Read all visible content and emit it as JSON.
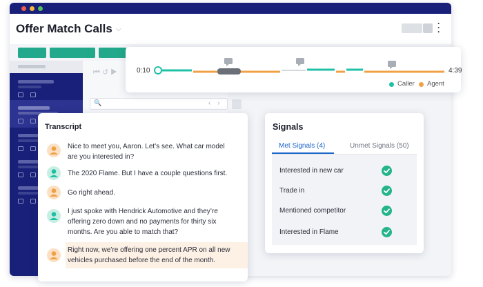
{
  "header": {
    "title": "Offer Match Calls"
  },
  "timeline": {
    "start_time": "0:10",
    "end_time": "4:39",
    "legend": [
      {
        "label": "Caller",
        "color": "#1fc1a6"
      },
      {
        "label": "Agent",
        "color": "#f0a045"
      }
    ],
    "comment_icon": "comment-icon"
  },
  "transcript": {
    "title": "Transcript",
    "messages": [
      {
        "speaker": "agent",
        "line1": "Nice to meet you, Aaron. Let’s see. What car model",
        "line2": "are you interested in?"
      },
      {
        "speaker": "caller",
        "line1": "The 2020 Flame. But I have a couple questions first.",
        "line2": ""
      },
      {
        "speaker": "agent",
        "line1": "Go right ahead.",
        "line2": ""
      },
      {
        "speaker": "caller",
        "line1": "I just spoke with Hendrick Automotive and they’re",
        "line2": "offering zero down and no payments for thirty six",
        "line3": "months. Are you able to match that?"
      },
      {
        "speaker": "agent",
        "line1": "Right now, we’re offering one percent APR on all new",
        "line2": "vehicles purchased before the end of the month.",
        "highlighted": true
      }
    ]
  },
  "signals": {
    "title": "Signals",
    "tabs": [
      {
        "label": "Met Signals (4)",
        "active": true
      },
      {
        "label": "Unmet Signals (50)",
        "active": false
      }
    ],
    "items": [
      {
        "label": "Interested in new car",
        "met": true
      },
      {
        "label": "Trade in",
        "met": true
      },
      {
        "label": "Mentioned competitor",
        "met": true
      },
      {
        "label": "Interested in Flame",
        "met": true
      }
    ]
  },
  "colors": {
    "brand_navy": "#19207a",
    "accent_green": "#22a88a",
    "caller": "#1fc1a6",
    "agent": "#f0a045",
    "link_blue": "#1d66c9",
    "check_green": "#25b48b"
  }
}
